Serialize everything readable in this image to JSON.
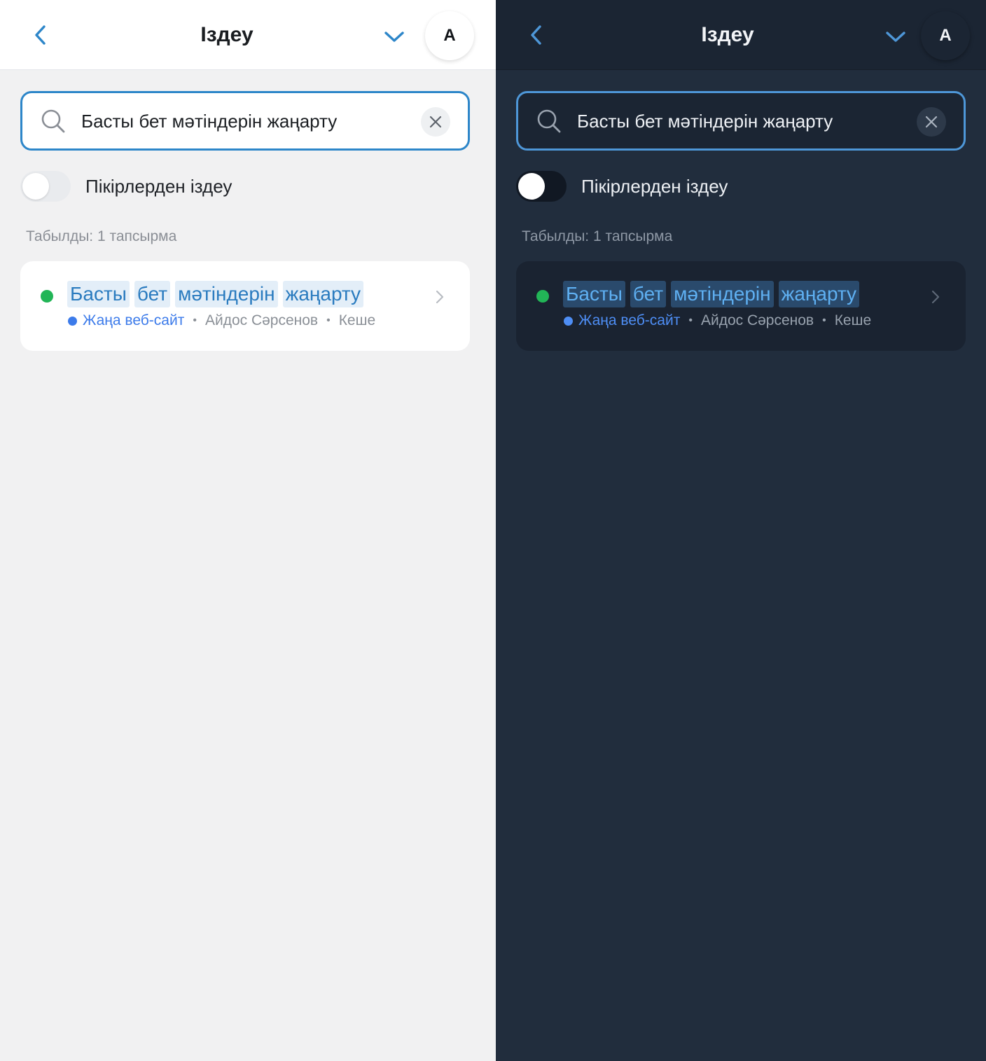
{
  "themes": [
    {
      "header": {
        "title": "Іздеу",
        "avatar_letter": "A"
      },
      "search": {
        "value": "Басты бет мәтіндерін жаңарту"
      },
      "toggle": {
        "label": "Пікірлерден іздеу",
        "on": false
      },
      "results": {
        "found_text": "Табылды: 1 тапсырма"
      },
      "task": {
        "title_words": [
          "Басты",
          "бет",
          "мәтіндерін",
          "жаңарту"
        ],
        "project": "Жаңа веб-сайт",
        "separator": "•",
        "assignee": "Айдос Сәрсенов",
        "due": "Кеше"
      }
    },
    {
      "header": {
        "title": "Іздеу",
        "avatar_letter": "A"
      },
      "search": {
        "value": "Басты бет мәтіндерін жаңарту"
      },
      "toggle": {
        "label": "Пікірлерден іздеу",
        "on": false
      },
      "results": {
        "found_text": "Табылды: 1 тапсырма"
      },
      "task": {
        "title_words": [
          "Басты",
          "бет",
          "мәтіндерін",
          "жаңарту"
        ],
        "project": "Жаңа веб-сайт",
        "separator": "•",
        "assignee": "Айдос Сәрсенов",
        "due": "Кеше"
      }
    }
  ],
  "colors": {
    "accent": "#2d86c9",
    "status_green": "#22b557",
    "project_blue": "#3c7bea",
    "light_bg": "#f1f1f2",
    "dark_bg": "#212d3d"
  },
  "icons": {
    "back": "chevron-left-icon",
    "expand": "chevron-down-icon",
    "search": "search-icon",
    "clear": "close-icon",
    "open": "chevron-right-icon"
  }
}
